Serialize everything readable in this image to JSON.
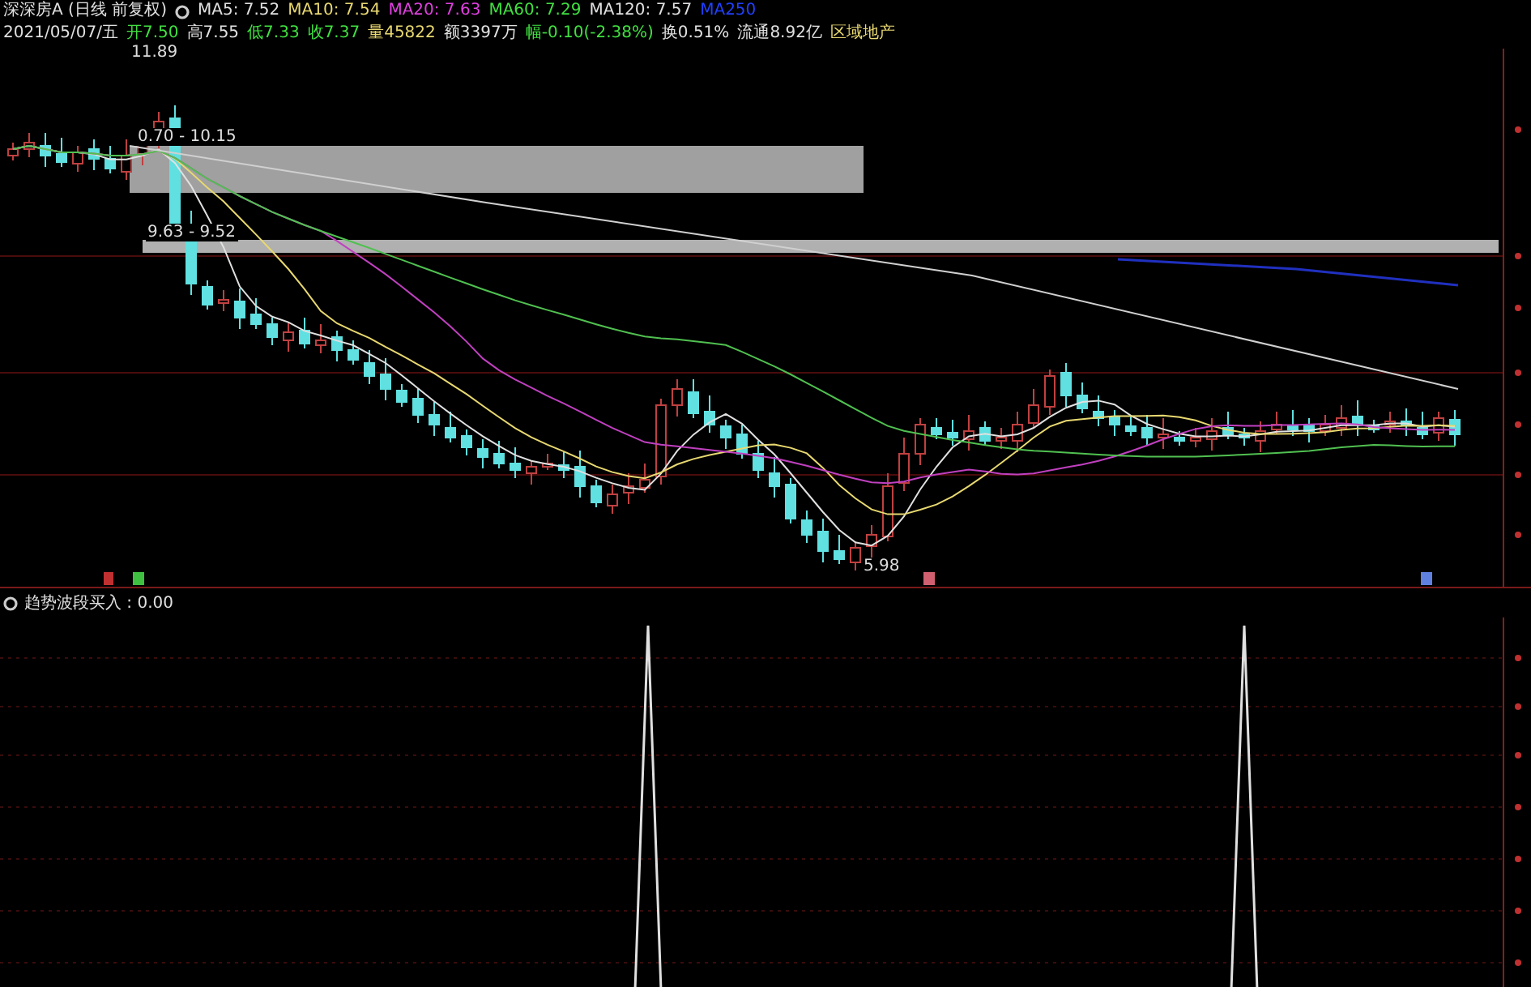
{
  "header": {
    "title": "深深房A (日线 前复权)",
    "indicators": [
      {
        "label": "MA5: 7.52",
        "color": "#e0e0e0"
      },
      {
        "label": "MA10: 7.54",
        "color": "#e8d870"
      },
      {
        "label": "MA20: 7.63",
        "color": "#e040e0"
      },
      {
        "label": "MA60: 7.29",
        "color": "#40e040"
      },
      {
        "label": "MA120: 7.57",
        "color": "#e0e0e0"
      },
      {
        "label": "MA250",
        "color": "#2040ff"
      }
    ],
    "quote": [
      {
        "text": "2021/05/07/五",
        "color": "#e0e0e0"
      },
      {
        "text": "开7.50",
        "color": "#40e040"
      },
      {
        "text": "高7.55",
        "color": "#e0e0e0"
      },
      {
        "text": "低7.33",
        "color": "#40e040"
      },
      {
        "text": "收7.37",
        "color": "#40e040"
      },
      {
        "text": "量45822",
        "color": "#e8d870"
      },
      {
        "text": "额3397万",
        "color": "#e0e0e0"
      },
      {
        "text": "幅-0.10(-2.38%)",
        "color": "#40e040"
      },
      {
        "text": "换0.51%",
        "color": "#e0e0e0"
      },
      {
        "text": "流通8.92亿",
        "color": "#e0e0e0"
      },
      {
        "text": "区域地产",
        "color": "#e8d870"
      }
    ]
  },
  "price_labels": {
    "high": "11.89",
    "zone_upper": "0.70 - 10.15",
    "zone_lower": "9.63 - 9.52",
    "low": "5.98"
  },
  "indicator_panel": {
    "label": "趋势波段买入 : 0.00"
  }
}
